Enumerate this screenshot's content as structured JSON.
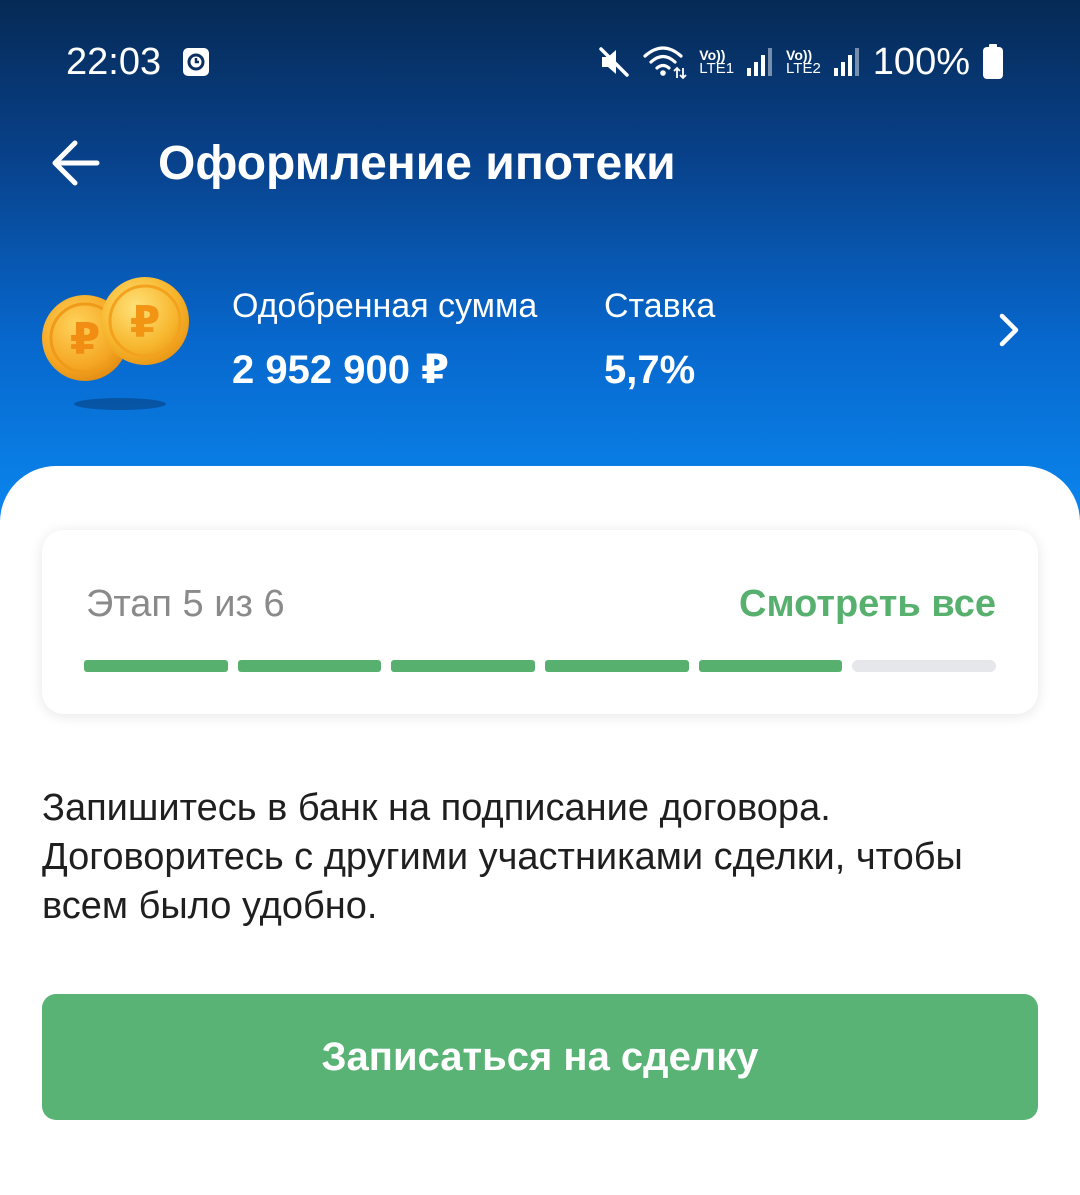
{
  "status_bar": {
    "time": "22:03",
    "sim1_top": "Vo))",
    "sim1_bottom": "LTE1",
    "sim2_top": "Vo))",
    "sim2_bottom": "LTE2",
    "battery": "100%",
    "icons": [
      "clock-icon",
      "mute-icon",
      "wifi-icon",
      "signal-icon",
      "signal-icon",
      "battery-icon"
    ]
  },
  "header": {
    "title": "Оформление ипотеки",
    "back_icon": "arrow-left-icon"
  },
  "summary": {
    "approved_label": "Одобренная сумма",
    "approved_value": "2 952 900 ₽",
    "rate_label": "Ставка",
    "rate_value": "5,7%",
    "chevron_icon": "chevron-right-icon"
  },
  "stage": {
    "label": "Этап 5 из 6",
    "see_all": "Смотреть все",
    "current": 5,
    "total": 6
  },
  "description": {
    "text": "Запишитесь в банк на подписание договора. Договоритесь с другими участниками сделки, чтобы всем было удобно."
  },
  "cta": {
    "label": "Записаться на сделку"
  },
  "colors": {
    "accent_green": "#58b374",
    "header_dark": "#062a55",
    "header_light": "#0a86ee",
    "progress_empty": "#e6e7ea"
  }
}
